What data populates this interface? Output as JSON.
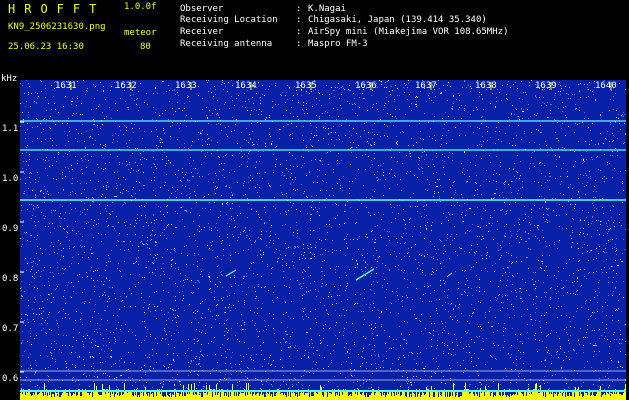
{
  "header": {
    "app_title": "HROFFT",
    "version": "1.0.0f",
    "filename": "KN9_2506231630.png",
    "meteor_label": "meteor",
    "datetime": "25.06.23 16:30",
    "meteor_count": "80"
  },
  "info": [
    {
      "label": "Observer",
      "value": "K.Nagai"
    },
    {
      "label": "Receiving Location",
      "value": "Chigasaki, Japan (139.414 35.340)"
    },
    {
      "label": "Receiver",
      "value": "AirSpy mini (Miakejima VOR 108.65MHz)"
    },
    {
      "label": "Receiving antenna",
      "value": "Maspro FM-3"
    }
  ],
  "plot": {
    "unit": "kHz",
    "y_ticks": [
      "1.1",
      "1.0",
      "0.9",
      "0.8",
      "0.7",
      "0.6"
    ],
    "x_ticks": [
      "1631",
      "1632",
      "1633",
      "1634",
      "1635",
      "1636",
      "1637",
      "1638",
      "1639",
      "1640"
    ],
    "colors": {
      "background": "#081fa8",
      "carrier": "#57ffe9",
      "label": "#ffffff",
      "yellow": "#f4ff00"
    }
  }
}
